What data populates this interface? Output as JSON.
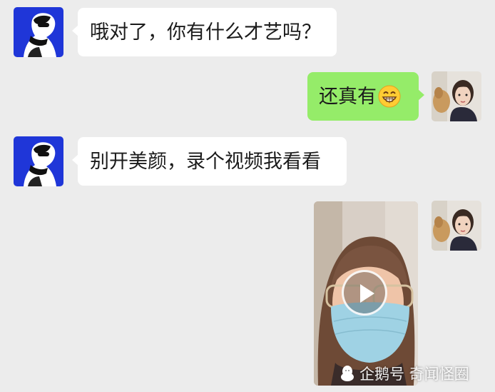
{
  "messages": [
    {
      "side": "in",
      "text": "哦对了，你有什么才艺吗？"
    },
    {
      "side": "out",
      "text": "还真有",
      "emoji": "grin-emoji"
    },
    {
      "side": "in",
      "text": "别开美颜，录个视频我看看"
    },
    {
      "side": "out",
      "type": "video"
    }
  ],
  "watermark": {
    "text": "企鹅号 奇闻怪圈"
  },
  "colors": {
    "background": "#ececec",
    "outgoing_bubble": "#95ec69",
    "incoming_bubble": "#ffffff"
  }
}
